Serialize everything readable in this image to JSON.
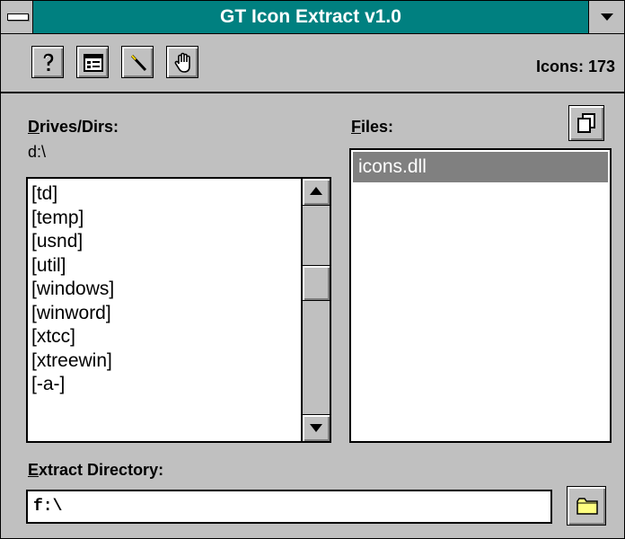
{
  "window": {
    "title": "GT Icon Extract v1.0"
  },
  "toolbar": {
    "buttons": [
      {
        "icon": "help-icon"
      },
      {
        "icon": "view-icon"
      },
      {
        "icon": "wand-icon"
      },
      {
        "icon": "hand-icon"
      }
    ],
    "icons_count_label": "Icons: 173"
  },
  "drives": {
    "label": "Drives/Dirs:",
    "label_rest": "rives/Dirs:",
    "label_key": "D",
    "current_dir": "d:\\",
    "items": [
      "[td]",
      "[temp]",
      "[usnd]",
      "[util]",
      "[windows]",
      "[winword]",
      "[xtcc]",
      "[xtreewin]",
      "[-a-]"
    ]
  },
  "files": {
    "label": "Files:",
    "label_rest": "iles:",
    "label_key": "F",
    "items": [
      {
        "name": "icons.dll",
        "selected": true
      }
    ]
  },
  "extract": {
    "label": "Extract Directory:",
    "label_rest": "xtract Directory:",
    "label_key": "E",
    "value": "f:\\"
  },
  "colors": {
    "titlebar": "#008080",
    "face": "#c0c0c0",
    "selection": "#808080"
  }
}
